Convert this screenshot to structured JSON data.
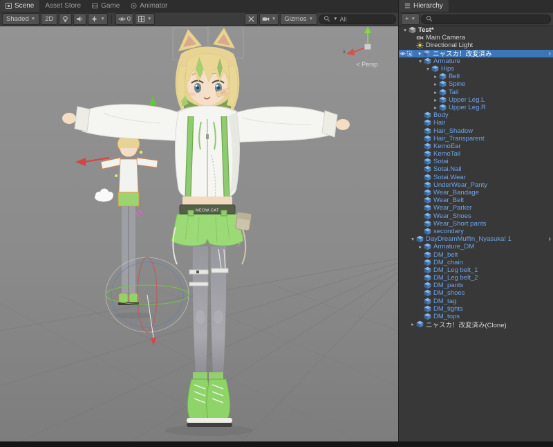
{
  "left_tabs": [
    {
      "label": "Scene",
      "active": true
    },
    {
      "label": "Asset Store",
      "active": false
    },
    {
      "label": "Game",
      "active": false
    },
    {
      "label": "Animator",
      "active": false
    }
  ],
  "scene_toolbar": {
    "shaded": "Shaded",
    "mode_2d": "2D",
    "visibility_count": "0",
    "gizmos": "Gizmos",
    "search_value": "All"
  },
  "scene_view": {
    "persp_label": "< Persp",
    "axis_x_label": "x",
    "belt_text": "MEOW-CAT"
  },
  "hierarchy_panel": {
    "tab_label": "Hierarchy",
    "add_button": "+",
    "items": [
      {
        "label": "Test*",
        "indent": 0,
        "icon": "unity-scene-icon",
        "arrow": "expanded",
        "style": "scene"
      },
      {
        "label": "Main Camera",
        "indent": 1,
        "icon": "camera-icon",
        "arrow": "none",
        "style": "normal"
      },
      {
        "label": "Directional Light",
        "indent": 1,
        "icon": "light-icon",
        "arrow": "none",
        "style": "normal"
      },
      {
        "label": "ニャスカ！改変済み",
        "indent": 1,
        "icon": "prefab-cube-icon",
        "arrow": "expanded",
        "style": "prefab",
        "selected": true,
        "gutter": true,
        "nav": true
      },
      {
        "label": "Armature",
        "indent": 2,
        "icon": "prefab-cube-icon",
        "arrow": "expanded",
        "style": "prefab"
      },
      {
        "label": "Hips",
        "indent": 3,
        "icon": "prefab-cube-icon",
        "arrow": "expanded",
        "style": "prefab"
      },
      {
        "label": "Belt",
        "indent": 4,
        "icon": "prefab-cube-icon",
        "arrow": "collapsed",
        "style": "prefab"
      },
      {
        "label": "Spine",
        "indent": 4,
        "icon": "prefab-cube-icon",
        "arrow": "collapsed",
        "style": "prefab"
      },
      {
        "label": "Tail",
        "indent": 4,
        "icon": "prefab-cube-icon",
        "arrow": "collapsed",
        "style": "prefab"
      },
      {
        "label": "Upper Leg.L",
        "indent": 4,
        "icon": "prefab-cube-icon",
        "arrow": "collapsed",
        "style": "prefab"
      },
      {
        "label": "Upper Leg.R",
        "indent": 4,
        "icon": "prefab-cube-icon",
        "arrow": "collapsed",
        "style": "prefab"
      },
      {
        "label": "Body",
        "indent": 2,
        "icon": "prefab-cube-icon",
        "arrow": "none",
        "style": "prefab"
      },
      {
        "label": "Hair",
        "indent": 2,
        "icon": "prefab-cube-icon",
        "arrow": "none",
        "style": "prefab"
      },
      {
        "label": "Hair_Shadow",
        "indent": 2,
        "icon": "prefab-cube-icon",
        "arrow": "none",
        "style": "prefab"
      },
      {
        "label": "Hair_Transparent",
        "indent": 2,
        "icon": "prefab-cube-icon",
        "arrow": "none",
        "style": "prefab"
      },
      {
        "label": "KemoEar",
        "indent": 2,
        "icon": "prefab-cube-icon",
        "arrow": "none",
        "style": "prefab"
      },
      {
        "label": "KemoTail",
        "indent": 2,
        "icon": "prefab-cube-icon",
        "arrow": "none",
        "style": "prefab"
      },
      {
        "label": "Sotai",
        "indent": 2,
        "icon": "prefab-cube-icon",
        "arrow": "none",
        "style": "prefab"
      },
      {
        "label": "Sotai.Nail",
        "indent": 2,
        "icon": "prefab-cube-icon",
        "arrow": "none",
        "style": "prefab"
      },
      {
        "label": "Sotai.Wear",
        "indent": 2,
        "icon": "prefab-cube-icon",
        "arrow": "none",
        "style": "prefab"
      },
      {
        "label": "UnderWear_Panty",
        "indent": 2,
        "icon": "prefab-cube-icon",
        "arrow": "none",
        "style": "prefab"
      },
      {
        "label": "Wear_Bandage",
        "indent": 2,
        "icon": "prefab-cube-icon",
        "arrow": "none",
        "style": "prefab"
      },
      {
        "label": "Wear_Belt",
        "indent": 2,
        "icon": "prefab-cube-icon",
        "arrow": "none",
        "style": "prefab"
      },
      {
        "label": "Wear_Parker",
        "indent": 2,
        "icon": "prefab-cube-icon",
        "arrow": "none",
        "style": "prefab"
      },
      {
        "label": "Wear_Shoes",
        "indent": 2,
        "icon": "prefab-cube-icon",
        "arrow": "none",
        "style": "prefab"
      },
      {
        "label": "Wear_Short pants",
        "indent": 2,
        "icon": "prefab-cube-icon",
        "arrow": "none",
        "style": "prefab"
      },
      {
        "label": "secondary",
        "indent": 2,
        "icon": "prefab-cube-icon",
        "arrow": "none",
        "style": "prefab"
      },
      {
        "label": "DayDreamMuffin_Nyasuka! 1",
        "indent": 1,
        "icon": "prefab-cube-icon",
        "arrow": "expanded",
        "style": "prefab",
        "nav": true
      },
      {
        "label": "Armature_DM",
        "indent": 2,
        "icon": "prefab-cube-icon",
        "arrow": "collapsed",
        "style": "prefab"
      },
      {
        "label": "DM_belt",
        "indent": 2,
        "icon": "prefab-cube-icon",
        "arrow": "none",
        "style": "prefab"
      },
      {
        "label": "DM_chain",
        "indent": 2,
        "icon": "prefab-cube-icon",
        "arrow": "none",
        "style": "prefab"
      },
      {
        "label": "DM_Leg belt_1",
        "indent": 2,
        "icon": "prefab-cube-icon",
        "arrow": "none",
        "style": "prefab"
      },
      {
        "label": "DM_Leg belt_2",
        "indent": 2,
        "icon": "prefab-cube-icon",
        "arrow": "none",
        "style": "prefab"
      },
      {
        "label": "DM_pants",
        "indent": 2,
        "icon": "prefab-cube-icon",
        "arrow": "none",
        "style": "prefab"
      },
      {
        "label": "DM_shoes",
        "indent": 2,
        "icon": "prefab-cube-icon",
        "arrow": "none",
        "style": "prefab"
      },
      {
        "label": "DM_tag",
        "indent": 2,
        "icon": "prefab-cube-icon",
        "arrow": "none",
        "style": "prefab"
      },
      {
        "label": "DM_tights",
        "indent": 2,
        "icon": "prefab-cube-icon",
        "arrow": "none",
        "style": "prefab"
      },
      {
        "label": "DM_tops",
        "indent": 2,
        "icon": "prefab-cube-icon",
        "arrow": "none",
        "style": "prefab"
      },
      {
        "label": "ニャスカ！改変済み(Clone)",
        "indent": 1,
        "icon": "prefab-cube-icon",
        "arrow": "collapsed",
        "style": "normal"
      }
    ]
  },
  "colors": {
    "selection_blue": "#3B76BB",
    "prefab_text": "#6FA3E8",
    "panel_bg": "#383838",
    "toolbar_bg": "#3C3C3C",
    "scene_bg": "#8B8B8B",
    "accent_green": "#8FCB70"
  }
}
